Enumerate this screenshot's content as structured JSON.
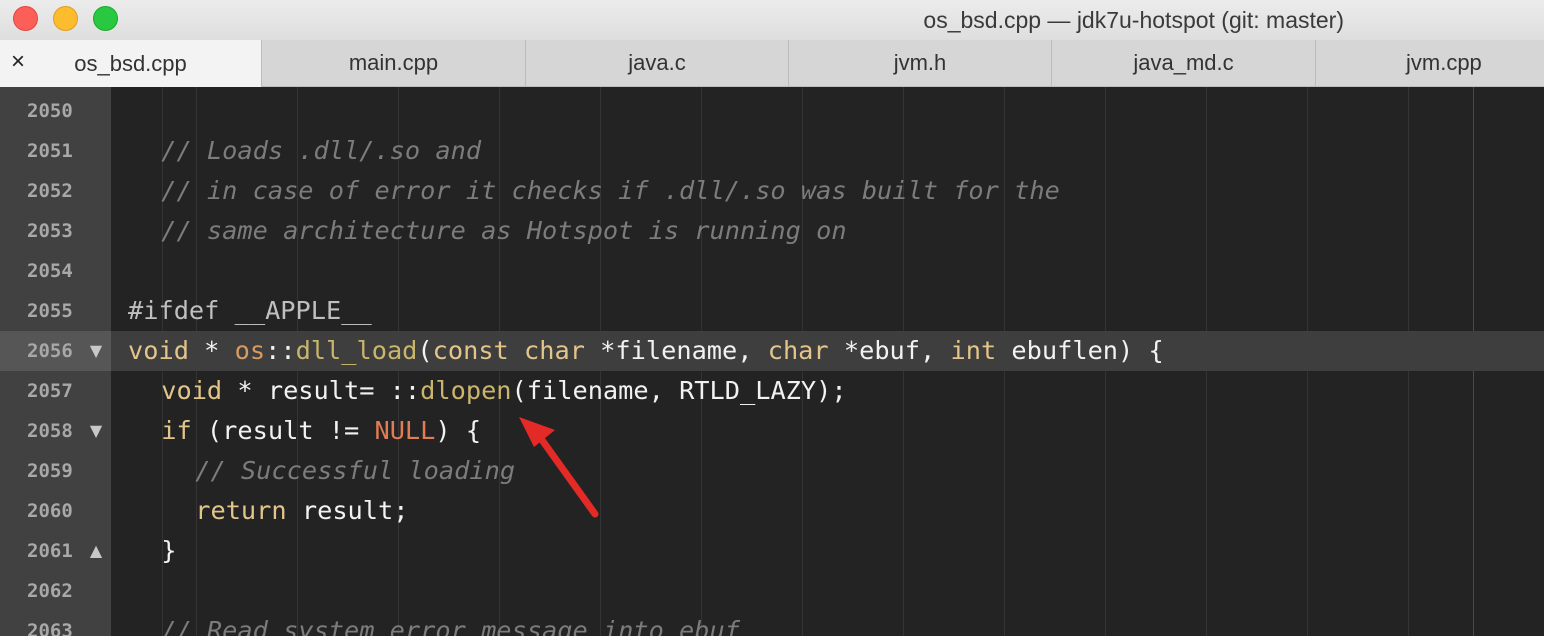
{
  "window": {
    "title": "os_bsd.cpp — jdk7u-hotspot (git: master)"
  },
  "tabs": [
    {
      "label": "os_bsd.cpp",
      "active": true,
      "close_glyph": "×"
    },
    {
      "label": "main.cpp"
    },
    {
      "label": "java.c"
    },
    {
      "label": "jvm.h"
    },
    {
      "label": "java_md.c"
    },
    {
      "label": "jvm.cpp"
    }
  ],
  "colors": {
    "arrow": "#e42a27",
    "keyword": "#e3c58a",
    "comment": "#7c7c7c",
    "null": "#e07d55"
  },
  "fold_glyphs": {
    "down": "▼",
    "up": "▲"
  },
  "lines": [
    {
      "num": "2050"
    },
    {
      "num": "2051",
      "t": [
        " ",
        "// Loads .dll/.so and"
      ]
    },
    {
      "num": "2052",
      "t": [
        " ",
        "// in case of error it checks if .dll/.so was built for the"
      ]
    },
    {
      "num": "2053",
      "t": [
        " ",
        "// same architecture as Hotspot is running on"
      ]
    },
    {
      "num": "2054"
    },
    {
      "num": "2055",
      "t": [
        "#ifdef __APPLE__"
      ]
    },
    {
      "num": "2056",
      "t": [
        "void",
        " * ",
        "os",
        "::",
        "dll_load",
        "(",
        "const",
        " ",
        "char",
        " *filename, ",
        "char",
        " *ebuf, ",
        "int",
        " ebuflen) {"
      ]
    },
    {
      "num": "2057",
      "t": [
        " ",
        "void",
        " * result= ::",
        "dlopen",
        "(filename, RTLD_LAZY);"
      ]
    },
    {
      "num": "2058",
      "t": [
        " ",
        "if",
        " (result != ",
        "NULL",
        ") {"
      ]
    },
    {
      "num": "2059",
      "t": [
        " ",
        "// Successful loading"
      ]
    },
    {
      "num": "2060",
      "t": [
        " ",
        "return",
        " result;"
      ]
    },
    {
      "num": "2061",
      "t": [
        " ",
        "}"
      ]
    },
    {
      "num": "2062"
    },
    {
      "num": "2063",
      "t": [
        " ",
        "// Read system error message into ebuf"
      ]
    }
  ]
}
